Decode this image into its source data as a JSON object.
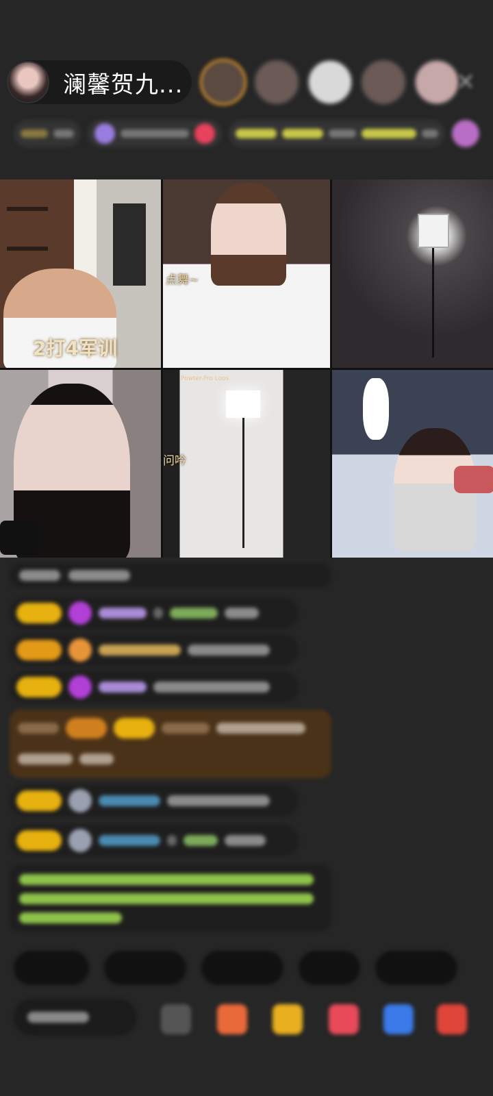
{
  "header": {
    "host_name": "澜馨贺九...",
    "close_icon": "close-icon"
  },
  "video_grid": {
    "tiles": [
      {
        "label": "2打4军训"
      },
      {
        "label": "点舞~"
      },
      {
        "label": ""
      },
      {
        "label": ""
      },
      {
        "label": "问吟",
        "tiny_label": "Powter-Fro Loos"
      },
      {
        "label": ""
      }
    ]
  },
  "colors": {
    "background": "#262626",
    "level_badge": "#e7b10f",
    "highlight_message": "#4a3218",
    "system_text": "#8fc24a"
  }
}
